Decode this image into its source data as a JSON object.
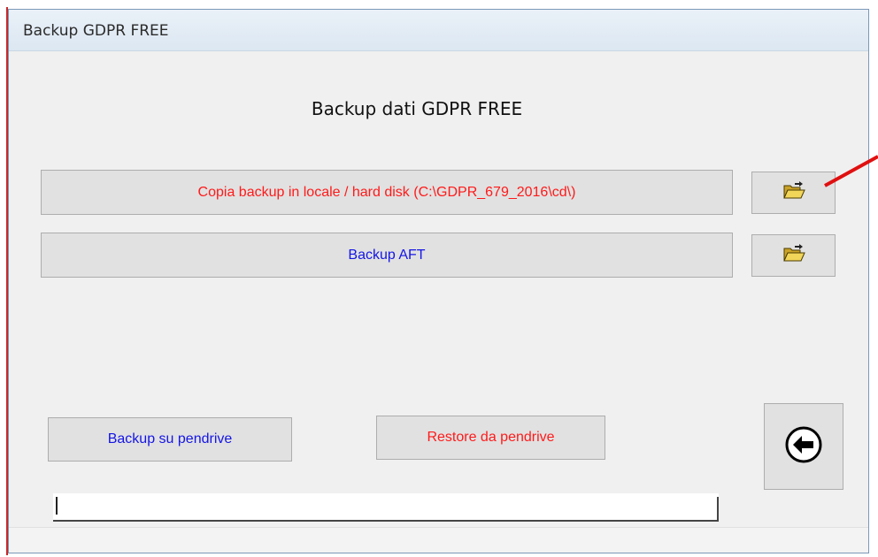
{
  "window": {
    "title": "Backup GDPR FREE"
  },
  "heading": "Backup dati GDPR FREE",
  "buttons": {
    "copy_local": "Copia backup in locale / hard disk (C:\\GDPR_679_2016\\cd\\)",
    "backup_aft": "Backup AFT",
    "backup_pendrive": "Backup su pendrive",
    "restore_pendrive": "Restore da pendrive"
  },
  "icons": {
    "folder": "open-folder-icon",
    "back": "back-arrow-icon"
  },
  "colors": {
    "red_text": "#ff1a1a",
    "blue_text": "#1515e6",
    "annotation": "#e01010"
  }
}
